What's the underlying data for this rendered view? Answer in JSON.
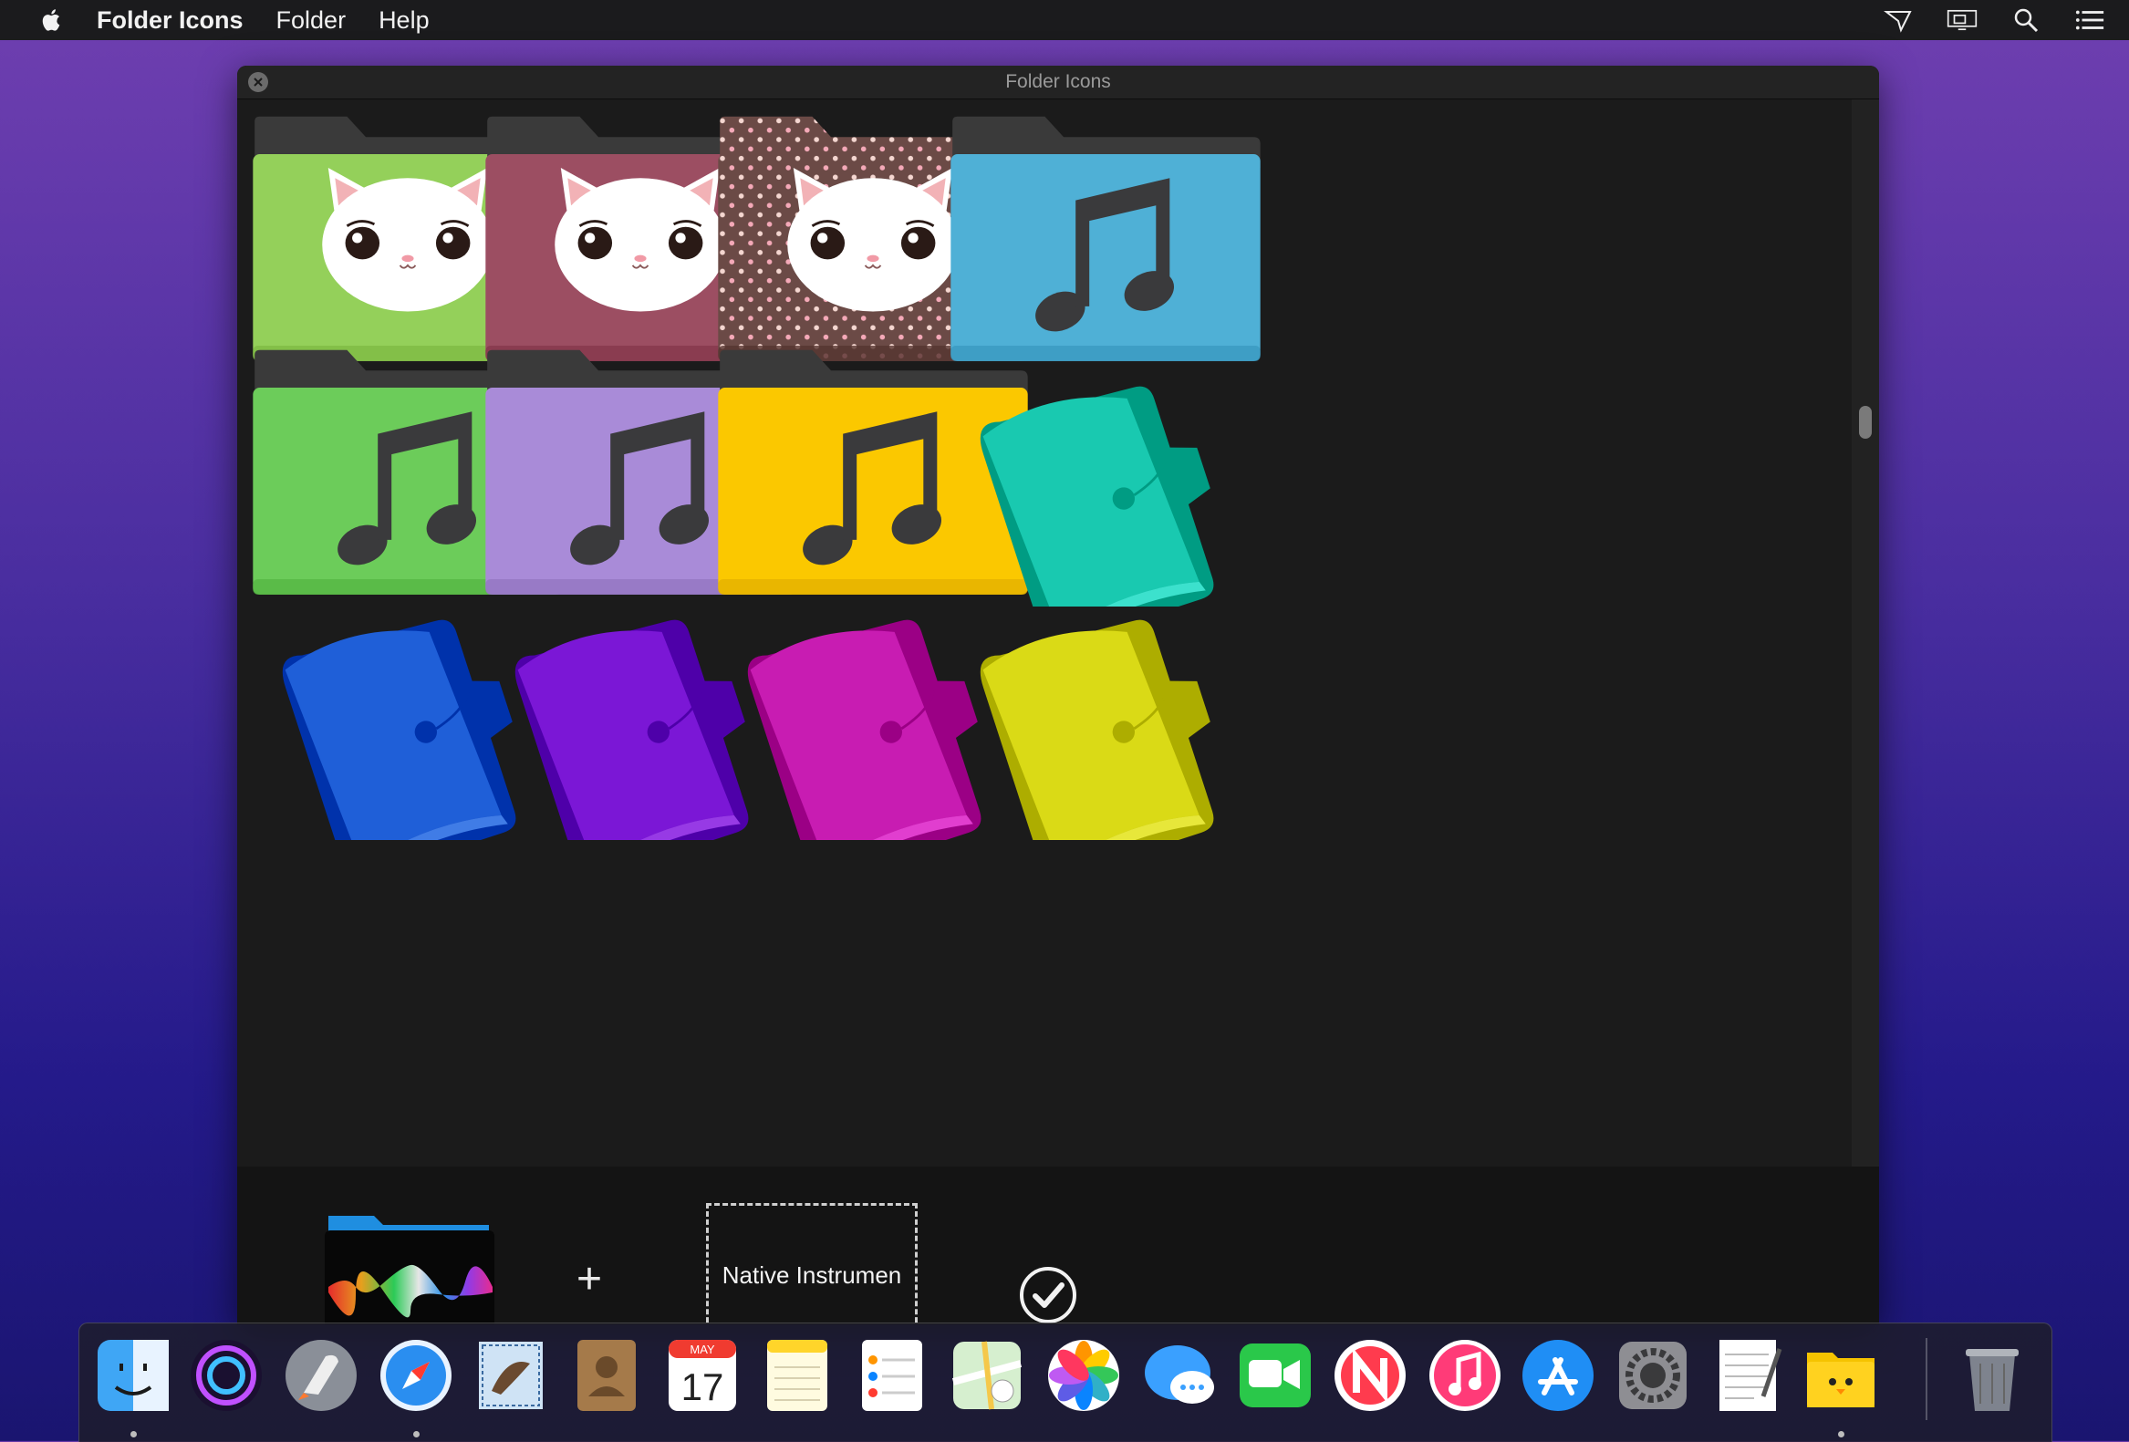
{
  "menubar": {
    "app_name": "Folder Icons",
    "menus": [
      "Folder",
      "Help"
    ],
    "status_icons": [
      "airplay-icon",
      "display-icon",
      "spotlight-search-icon",
      "notification-center-icon"
    ]
  },
  "window": {
    "title": "Folder Icons"
  },
  "folder_grid": [
    {
      "kind": "cat",
      "color": "#94d05a"
    },
    {
      "kind": "cat",
      "color": "#9c4e62"
    },
    {
      "kind": "cat-dots",
      "color": "#6b4a46"
    },
    {
      "kind": "music",
      "color": "#4fb0d6"
    },
    {
      "kind": "music",
      "color": "#6ccc5a"
    },
    {
      "kind": "music",
      "color": "#a98bd8"
    },
    {
      "kind": "music",
      "color": "#fbc800"
    },
    {
      "kind": "tilted",
      "color": "#19c9b0"
    },
    {
      "kind": "tilted",
      "color": "#1f5fd8"
    },
    {
      "kind": "tilted",
      "color": "#7b17d6"
    },
    {
      "kind": "tilted",
      "color": "#c81cb2"
    },
    {
      "kind": "tilted",
      "color": "#dada16"
    }
  ],
  "panel": {
    "plus": "+",
    "target_name": "Native Instrumen"
  },
  "dock": {
    "apps": [
      "finder-icon",
      "siri-icon",
      "launchpad-icon",
      "safari-icon",
      "mail-icon",
      "contacts-icon",
      "calendar-icon",
      "notes-icon",
      "reminders-icon",
      "maps-icon",
      "photos-icon",
      "messages-icon",
      "facetime-icon",
      "news-icon",
      "music-icon",
      "app-store-icon",
      "system-preferences-icon",
      "textedit-icon",
      "folder-icons-app-icon",
      "trash-icon"
    ],
    "calendar_month": "MAY",
    "calendar_day": "17"
  }
}
